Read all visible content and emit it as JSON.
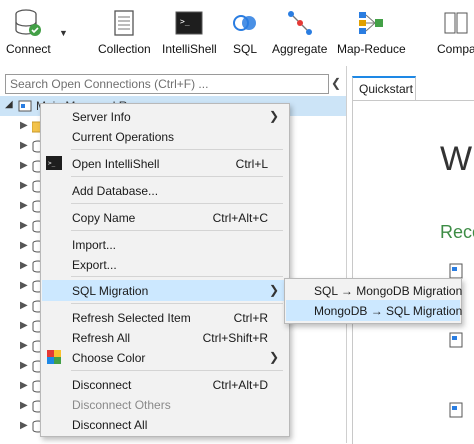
{
  "toolbar": {
    "connect": "Connect",
    "collection": "Collection",
    "intellishell": "IntelliShell",
    "sql": "SQL",
    "aggregate": "Aggregate",
    "map_reduce": "Map-Reduce",
    "compare": "Compa"
  },
  "sidebar": {
    "search_placeholder": "Search Open Connections (Ctrl+F) ...",
    "connection_name": "Main Managed Rs..."
  },
  "tabs": {
    "quickstart": "Quickstart"
  },
  "quickstart": {
    "welcome": "W",
    "recent": "Rece"
  },
  "context_menu": {
    "server_info": "Server Info",
    "current_operations": "Current Operations",
    "open_intellishell": "Open IntelliShell",
    "open_intellishell_shortcut": "Ctrl+L",
    "add_database": "Add Database...",
    "copy_name": "Copy Name",
    "copy_name_shortcut": "Ctrl+Alt+C",
    "import": "Import...",
    "export": "Export...",
    "sql_migration": "SQL Migration",
    "refresh_selected": "Refresh Selected Item",
    "refresh_selected_shortcut": "Ctrl+R",
    "refresh_all": "Refresh All",
    "refresh_all_shortcut": "Ctrl+Shift+R",
    "choose_color": "Choose Color",
    "disconnect": "Disconnect",
    "disconnect_shortcut": "Ctrl+Alt+D",
    "disconnect_others": "Disconnect Others",
    "disconnect_all": "Disconnect All"
  },
  "submenu": {
    "sql_to_mongo": "SQL → MongoDB Migration",
    "mongo_to_sql": "MongoDB → SQL Migration"
  },
  "colors": {
    "highlight": "#cce8ff",
    "accent_green": "#3d8c45",
    "selection": "#cce4f7"
  }
}
